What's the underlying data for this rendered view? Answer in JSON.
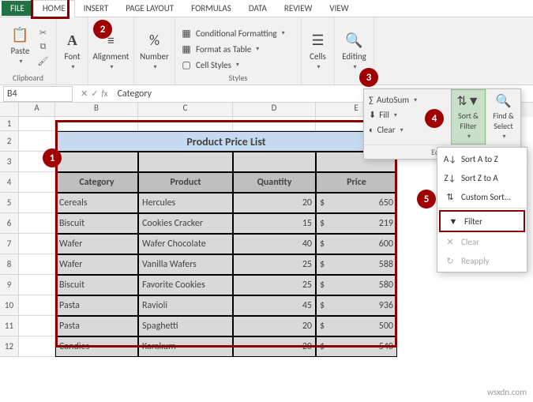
{
  "tabs": {
    "file": "FILE",
    "home": "HOME",
    "insert": "INSERT",
    "pageLayout": "PAGE LAYOUT",
    "formulas": "FORMULAS",
    "data": "DATA",
    "review": "REVIEW",
    "view": "VIEW"
  },
  "ribbon": {
    "clipboard": {
      "paste": "Paste",
      "label": "Clipboard"
    },
    "font": {
      "btn": "Font",
      "label": "Font"
    },
    "alignment": {
      "btn": "Alignment"
    },
    "number": {
      "btn": "Number"
    },
    "styles": {
      "condFmt": "Conditional Formatting",
      "fmtTable": "Format as Table",
      "cellStyles": "Cell Styles",
      "label": "Styles"
    },
    "cells": {
      "btn": "Cells"
    },
    "editing": {
      "btn": "Editing"
    }
  },
  "editpop": {
    "autosum": "AutoSum",
    "fill": "Fill",
    "clear": "Clear",
    "sortFilter": "Sort & Filter",
    "findSelect": "Find & Select",
    "footer": "Editing"
  },
  "sortmenu": {
    "sortAZ": "Sort A to Z",
    "sortZA": "Sort Z to A",
    "custom": "Custom Sort...",
    "filter": "Filter",
    "clear": "Clear",
    "reapply": "Reapply"
  },
  "formula": {
    "ref": "B4",
    "fx": "Category"
  },
  "colHeaders": [
    "A",
    "B",
    "C",
    "D",
    "E"
  ],
  "rowHeaders": [
    "1",
    "2",
    "3",
    "4",
    "5",
    "6",
    "7",
    "8",
    "9",
    "10",
    "11",
    "12"
  ],
  "table": {
    "title": "Product Price List",
    "headers": {
      "cat": "Category",
      "prod": "Product",
      "qty": "Quantity",
      "price": "Price"
    },
    "currency": "$",
    "rows": [
      {
        "cat": "Cereals",
        "prod": "Hercules",
        "qty": 20,
        "price": 650
      },
      {
        "cat": "Biscuit",
        "prod": "Cookies Cracker",
        "qty": 15,
        "price": 219
      },
      {
        "cat": "Wafer",
        "prod": "Wafer Chocolate",
        "qty": 40,
        "price": 600
      },
      {
        "cat": "Wafer",
        "prod": "Vanilla Wafers",
        "qty": 25,
        "price": 588
      },
      {
        "cat": "Biscuit",
        "prod": "Favorite Cookies",
        "qty": 25,
        "price": 580
      },
      {
        "cat": "Pasta",
        "prod": "Ravioli",
        "qty": 45,
        "price": 936
      },
      {
        "cat": "Pasta",
        "prod": "Spaghetti",
        "qty": 20,
        "price": 500
      },
      {
        "cat": "Candies",
        "prod": "Karakum",
        "qty": 20,
        "price": 540
      }
    ]
  },
  "badges": {
    "b1": "1",
    "b2": "2",
    "b3": "3",
    "b4": "4",
    "b5": "5"
  },
  "watermark": "wsxdn.com"
}
